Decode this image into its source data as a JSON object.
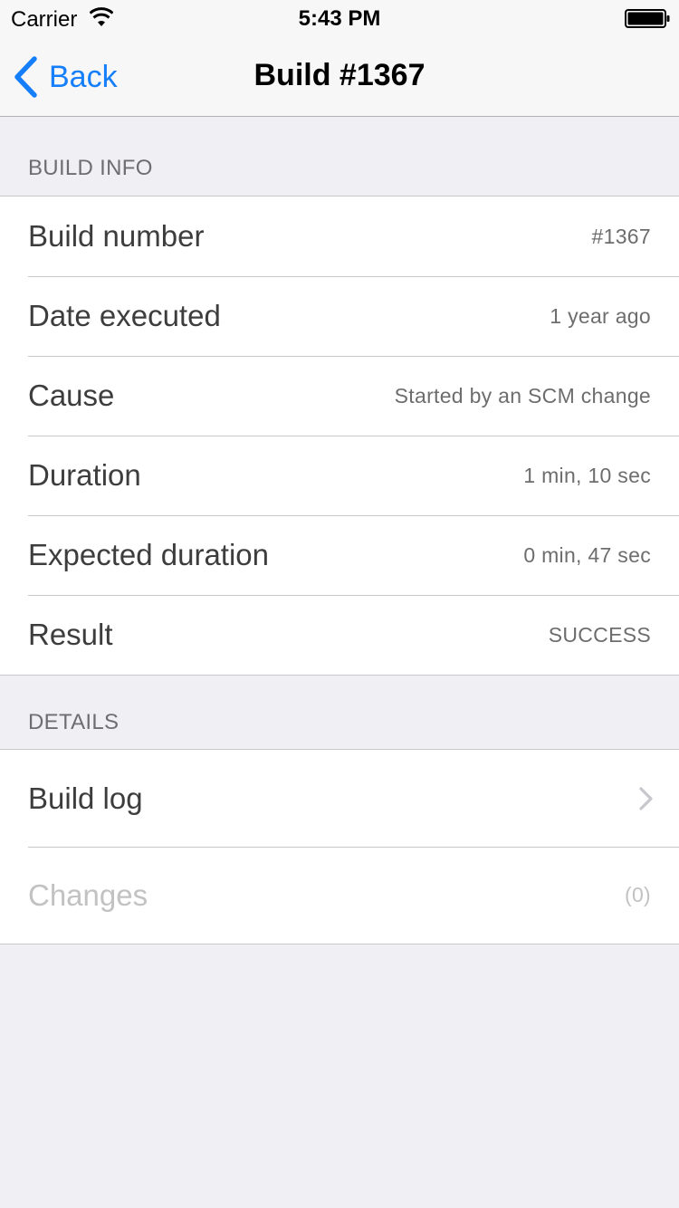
{
  "status_bar": {
    "carrier": "Carrier",
    "time": "5:43 PM",
    "wifi_icon": "wifi-icon",
    "battery_icon": "battery-icon"
  },
  "nav": {
    "back_label": "Back",
    "title": "Build #1367",
    "accent_color": "#147efb"
  },
  "build_info": {
    "header": "BUILD INFO",
    "rows": [
      {
        "label": "Build number",
        "value": "#1367"
      },
      {
        "label": "Date executed",
        "value": "1 year ago"
      },
      {
        "label": "Cause",
        "value": "Started by an SCM change"
      },
      {
        "label": "Duration",
        "value": "1 min, 10 sec"
      },
      {
        "label": "Expected duration",
        "value": "0 min, 47 sec"
      },
      {
        "label": "Result",
        "value": "SUCCESS"
      }
    ]
  },
  "details": {
    "header": "DETAILS",
    "rows": [
      {
        "label": "Build log",
        "accessory": "chevron-right-icon"
      },
      {
        "label": "Changes",
        "value": "(0)",
        "disabled": true
      }
    ]
  }
}
